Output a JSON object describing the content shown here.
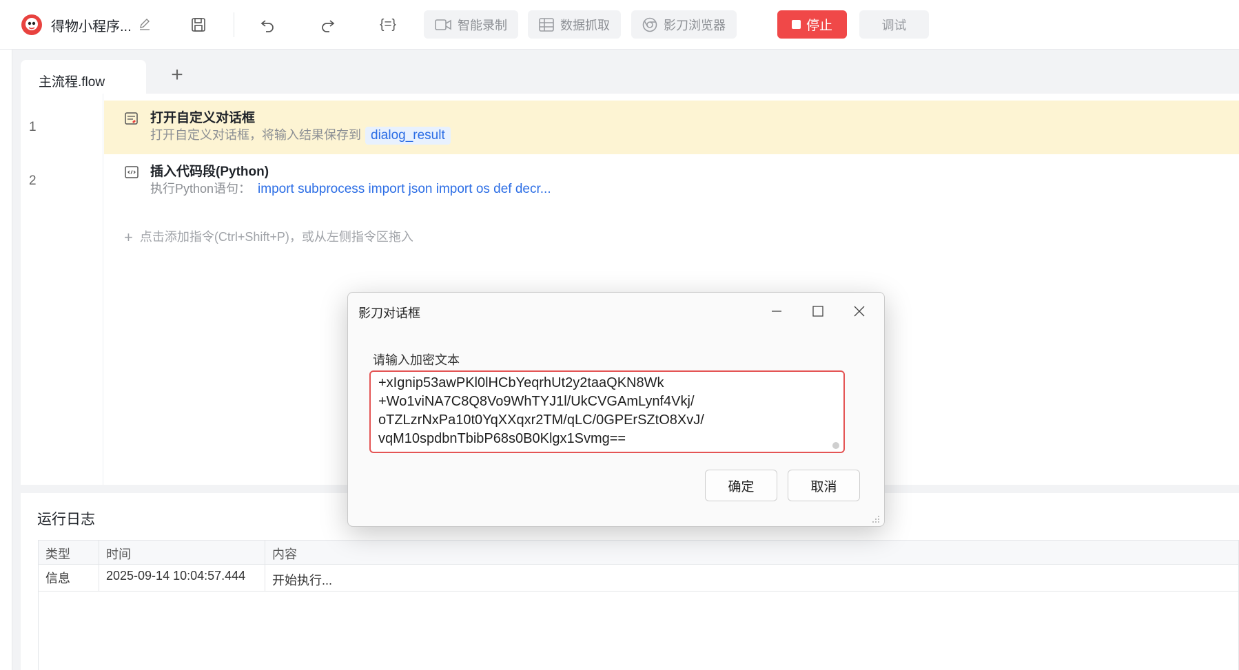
{
  "toolbar": {
    "app_title": "得物小程序...",
    "btn_record": "智能录制",
    "btn_capture": "数据抓取",
    "btn_browser": "影刀浏览器",
    "btn_stop": "停止",
    "btn_debug": "调试",
    "colors": {
      "stop_bg": "#f04848",
      "disabled_text": "#8c8f94"
    }
  },
  "editor": {
    "tab_label": "主流程.flow",
    "rows": [
      {
        "line": "1",
        "title": "打开自定义对话框",
        "desc": "打开自定义对话框，将输入结果保存到",
        "var": "dialog_result"
      },
      {
        "line": "2",
        "title": "插入代码段(Python)",
        "desc": "执行Python语句：",
        "code": "import subprocess import json import os   def decr..."
      }
    ],
    "add_hint": "点击添加指令(Ctrl+Shift+P)，或从左侧指令区拖入"
  },
  "log": {
    "title": "运行日志",
    "columns": [
      "类型",
      "时间",
      "内容"
    ],
    "rows": [
      {
        "type": "信息",
        "time": "2025-09-14 10:04:57.444",
        "content": "开始执行..."
      }
    ]
  },
  "dialog": {
    "title": "影刀对话框",
    "field_label": "请输入加密文本",
    "text_lines": [
      "+xIgnip53awPKl0lHCbYeqrhUt2y2taaQKN8Wk",
      "+Wo1viNA7C8Q8Vo9WhTYJ1l/UkCVGAmLynf4Vkj/",
      "oTZLzrNxPa10t0YqXXqxr2TM/qLC/0GPErSZtO8XvJ/",
      "vqM10spdbnTbibP68s0B0Klgx1Svmg=="
    ],
    "btn_ok": "确定",
    "btn_cancel": "取消",
    "colors": {
      "field_border": "#e45454"
    }
  }
}
